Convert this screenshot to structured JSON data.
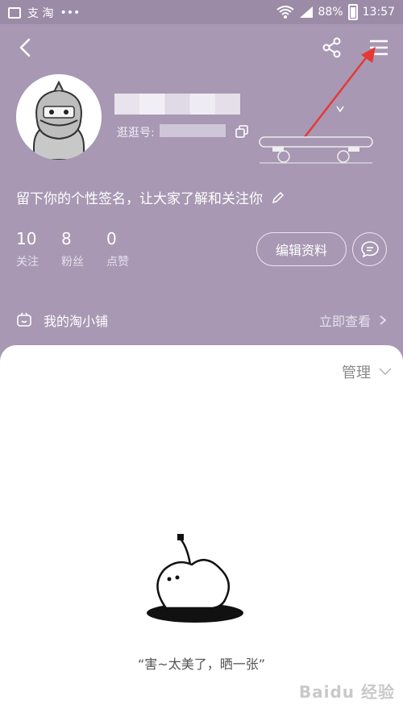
{
  "status_bar": {
    "app_labels": "支 淘",
    "dots": "•••",
    "battery_pct": "88%",
    "time": "13:57"
  },
  "profile": {
    "guang_label": "逛逛号:",
    "signature": "留下你的个性签名，让大家了解和关注你"
  },
  "stats": [
    {
      "num": "10",
      "label": "关注"
    },
    {
      "num": "8",
      "label": "粉丝"
    },
    {
      "num": "0",
      "label": "点赞"
    }
  ],
  "buttons": {
    "edit": "编辑资料"
  },
  "shop": {
    "label": "我的淘小铺",
    "link": "立即查看"
  },
  "content": {
    "manage": "管理",
    "empty_text": "“害~太美了，晒一张”"
  },
  "watermark": "Baidu 经验",
  "colors": {
    "header_bg": "#a898b3",
    "status_bg": "#9b8ba6",
    "arrow": "#e53935"
  }
}
